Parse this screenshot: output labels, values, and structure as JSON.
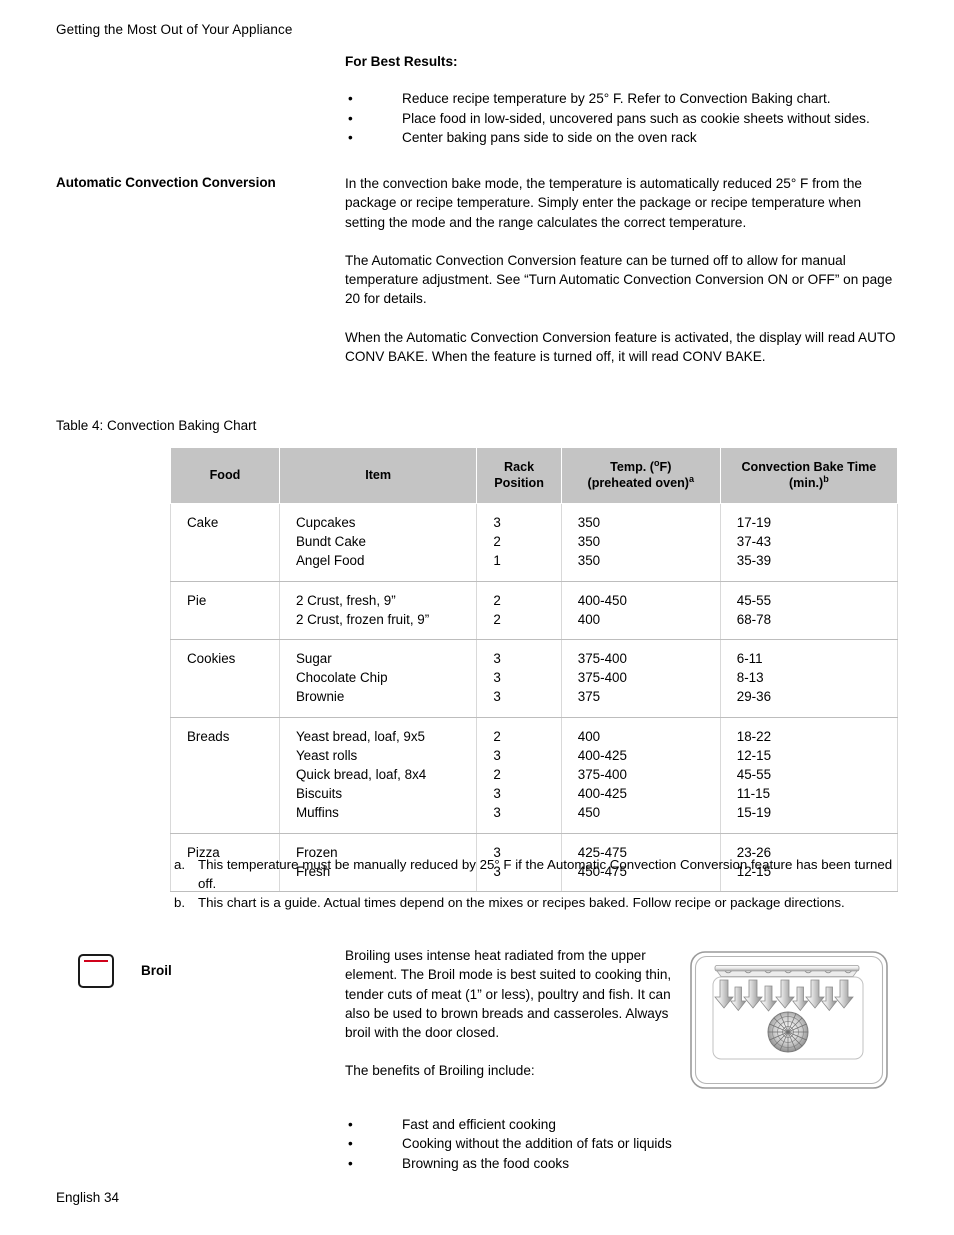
{
  "running_header": "Getting the Most Out of Your Appliance",
  "best_results": {
    "heading": "For Best Results:",
    "bullets": [
      "Reduce recipe temperature by 25° F. Refer to Convection Baking chart.",
      "Place food in low-sided, uncovered pans such as cookie sheets without sides.",
      "Center baking pans side to side on the oven rack"
    ]
  },
  "auto_convection": {
    "label": "Automatic Convection Conversion",
    "paragraphs": [
      "In the convection bake mode, the temperature is automatically reduced 25° F from the package or recipe temperature. Simply enter the package or recipe temperature when setting the mode and the range calculates the correct temperature.",
      "The Automatic Convection Conversion feature can be turned off to allow for manual temperature adjustment. See “Turn Automatic Convection Conversion ON or OFF” on page 20 for details.",
      "When the Automatic Convection Conversion feature is activated, the display will read AUTO CONV BAKE. When the feature is turned off, it will read CONV BAKE."
    ]
  },
  "table": {
    "caption": "Table 4: Convection Baking Chart",
    "headers": {
      "food": "Food",
      "item": "Item",
      "rack_line1": "Rack",
      "rack_line2": "Position",
      "temp_line1_pre": "Temp. (",
      "temp_line1_sup": "o",
      "temp_line1_post": "F)",
      "temp_line2": "(preheated oven)",
      "temp_line2_sup": "a",
      "time_line1": "Convection Bake Time",
      "time_line2": "(min.)",
      "time_line2_sup": "b"
    },
    "rows": [
      {
        "food": "Cake",
        "items": [
          "Cupcakes",
          "Bundt Cake",
          "Angel Food"
        ],
        "rack": [
          "3",
          "2",
          "1"
        ],
        "temp": [
          "350",
          "350",
          "350"
        ],
        "time": [
          "17-19",
          "37-43",
          "35-39"
        ]
      },
      {
        "food": "Pie",
        "items": [
          "2 Crust, fresh, 9”",
          "2 Crust, frozen fruit, 9”"
        ],
        "rack": [
          "2",
          "2"
        ],
        "temp": [
          "400-450",
          "400"
        ],
        "time": [
          "45-55",
          "68-78"
        ]
      },
      {
        "food": "Cookies",
        "items": [
          "Sugar",
          "Chocolate Chip",
          "Brownie"
        ],
        "rack": [
          "3",
          "3",
          "3"
        ],
        "temp": [
          "375-400",
          "375-400",
          "375"
        ],
        "time": [
          "6-11",
          "8-13",
          "29-36"
        ]
      },
      {
        "food": "Breads",
        "items": [
          "Yeast bread, loaf, 9x5",
          "Yeast rolls",
          "Quick bread, loaf, 8x4",
          "Biscuits",
          "Muffins"
        ],
        "rack": [
          "2",
          "3",
          "2",
          "3",
          "3"
        ],
        "temp": [
          "400",
          "400-425",
          "375-400",
          "400-425",
          "450"
        ],
        "time": [
          "18-22",
          "12-15",
          "45-55",
          "11-15",
          "15-19"
        ]
      },
      {
        "food": "Pizza",
        "items": [
          "Frozen",
          "Fresh"
        ],
        "rack": [
          "3",
          "3"
        ],
        "temp": [
          "425-475",
          "450-475"
        ],
        "time": [
          "23-26",
          "12-15"
        ]
      }
    ]
  },
  "footnotes": [
    {
      "marker": "a.",
      "text": "This temperature must be manually reduced by 25° F if the Automatic Convection Conversion feature has been turned off."
    },
    {
      "marker": "b.",
      "text": "This chart is a guide. Actual times depend on the mixes or recipes baked. Follow recipe or package directions."
    }
  ],
  "broil": {
    "label": "Broil",
    "icon_name": "broil-mode-icon",
    "icon_element_color": "#d0021b",
    "paragraphs": [
      "Broiling uses intense heat radiated from the upper element. The Broil mode is best suited to cooking thin, tender cuts of meat (1” or less), poultry and fish. It can also be used to brown breads and casseroles. Always broil with the door closed.",
      "The benefits of Broiling include:"
    ],
    "bullets": [
      "Fast and efficient cooking",
      "Cooking without the addition of fats or liquids",
      "Browning as the food cooks"
    ],
    "figure_name": "oven-broil-heat-diagram"
  },
  "footer": "English 34",
  "bullet_glyph": "•"
}
